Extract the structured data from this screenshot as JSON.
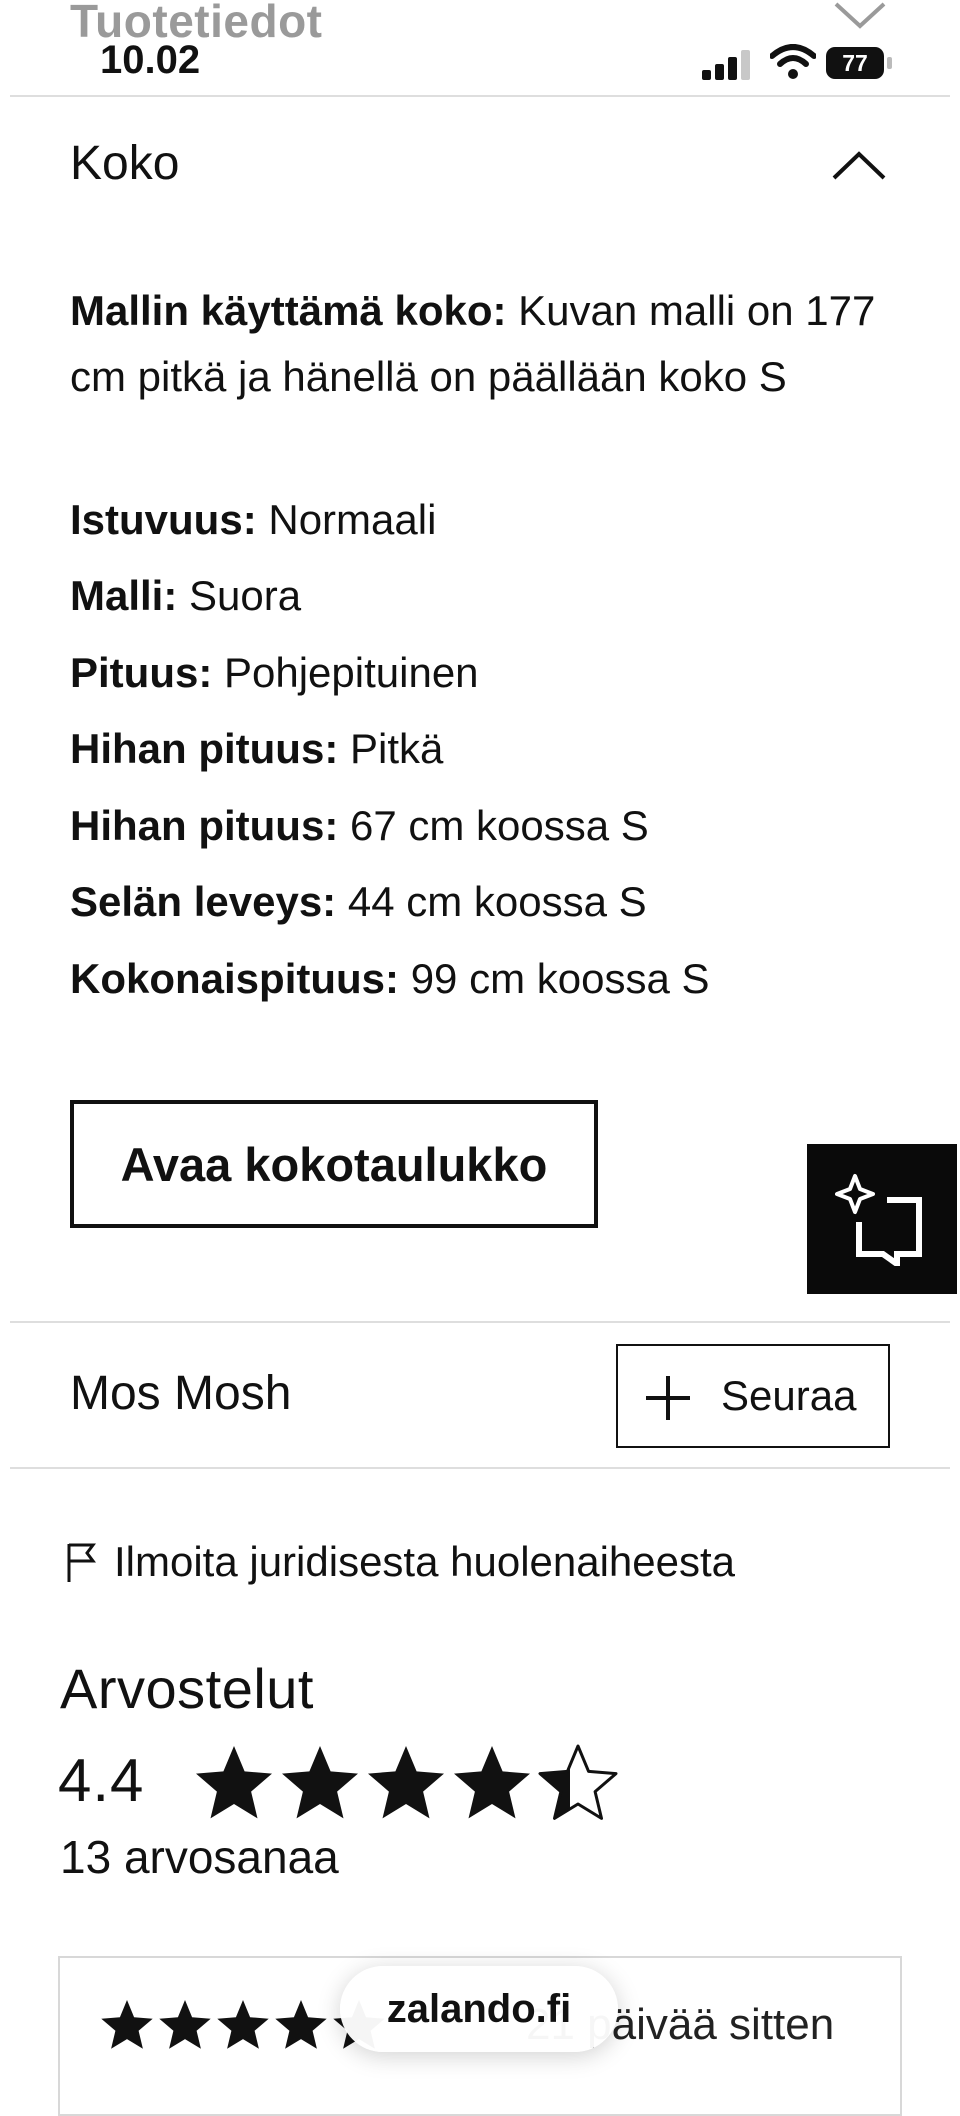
{
  "header": {
    "previous_section_title": "Tuotetiedot",
    "time": "10.02",
    "battery_percent": "77",
    "signal_bars": 3,
    "signal_bars_total": 4
  },
  "size_section": {
    "title": "Koko",
    "expanded": true,
    "attributes": [
      {
        "label": "Mallin käyttämä koko:",
        "value": "Kuvan malli on 177 cm pitkä ja hänellä on päällään koko S"
      },
      {
        "label": "Istuvuus:",
        "value": "Normaali"
      },
      {
        "label": "Malli:",
        "value": "Suora"
      },
      {
        "label": "Pituus:",
        "value": "Pohjepituinen"
      },
      {
        "label": "Hihan pituus:",
        "value": "Pitkä"
      },
      {
        "label": "Hihan pituus:",
        "value": "67 cm koossa S"
      },
      {
        "label": "Selän leveys:",
        "value": "44 cm koossa S"
      },
      {
        "label": "Kokonaispituus:",
        "value": "99 cm koossa S"
      }
    ],
    "size_chart_button": "Avaa kokotaulukko"
  },
  "brand": {
    "name": "Mos Mosh",
    "follow_label": "Seuraa"
  },
  "report_link": "Ilmoita juridisesta huolenaiheesta",
  "reviews": {
    "title": "Arvostelut",
    "average": "4.4",
    "average_stars": 4.4,
    "count_label": "13 arvosanaa",
    "first_review": {
      "stars": 5,
      "age": "21 päivää sitten"
    }
  },
  "browser": {
    "url": "zalando.fi"
  },
  "icons": {
    "collapse": "chevron-up-icon",
    "add": "plus-icon",
    "report": "flag-icon",
    "assistant": "sparkle-chat-icon"
  },
  "colors": {
    "text": "#111111",
    "divider": "#dedede",
    "assistant_bg": "#0a0a0a",
    "star": "#111111"
  }
}
